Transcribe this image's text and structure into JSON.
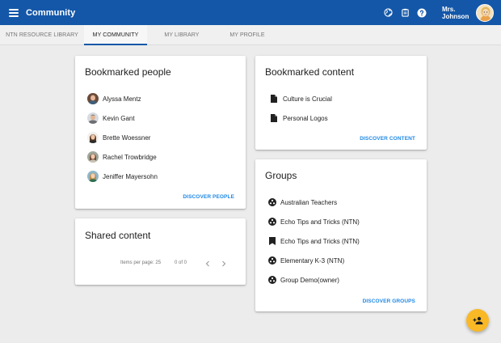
{
  "app": {
    "title": "Community",
    "user_name": "Mrs. Johnson",
    "icons": [
      "menu-icon",
      "globe-icon",
      "clipboard-icon",
      "help-icon"
    ]
  },
  "tabs": [
    {
      "label": "NTN RESOURCE LIBRARY",
      "active": false
    },
    {
      "label": "MY COMMUNITY",
      "active": true
    },
    {
      "label": "MY LIBRARY",
      "active": false
    },
    {
      "label": "MY PROFILE",
      "active": false
    }
  ],
  "bookmarked_people": {
    "title": "Bookmarked people",
    "people": [
      {
        "name": "Alyssa Mentz"
      },
      {
        "name": "Kevin Gant"
      },
      {
        "name": "Brette Woessner"
      },
      {
        "name": "Rachel Trowbridge"
      },
      {
        "name": "Jeniffer Mayersohn"
      }
    ],
    "link": "DISCOVER PEOPLE"
  },
  "shared_content": {
    "title": "Shared content",
    "items_per_page_label": "Items per page: 25",
    "range": "0 of 0"
  },
  "bookmarked_content": {
    "title": "Bookmarked content",
    "items": [
      {
        "label": "Culture is Crucial",
        "icon": "document-icon"
      },
      {
        "label": "Personal Logos",
        "icon": "document-icon"
      }
    ],
    "link": "DISCOVER CONTENT"
  },
  "groups": {
    "title": "Groups",
    "items": [
      {
        "label": "Australian Teachers",
        "icon": "group-icon"
      },
      {
        "label": "Echo Tips and Tricks (NTN)",
        "icon": "group-icon"
      },
      {
        "label": "Echo Tips and Tricks (NTN)",
        "icon": "bookmark-icon"
      },
      {
        "label": "Elementary K-3 (NTN)",
        "icon": "group-icon"
      },
      {
        "label": "Group Demo(owner)",
        "icon": "group-icon"
      }
    ],
    "link": "DISCOVER GROUPS"
  },
  "colors": {
    "appbar": "#1457a8",
    "link": "#1e88e5",
    "fab": "#f9b825",
    "background": "#ececec"
  }
}
